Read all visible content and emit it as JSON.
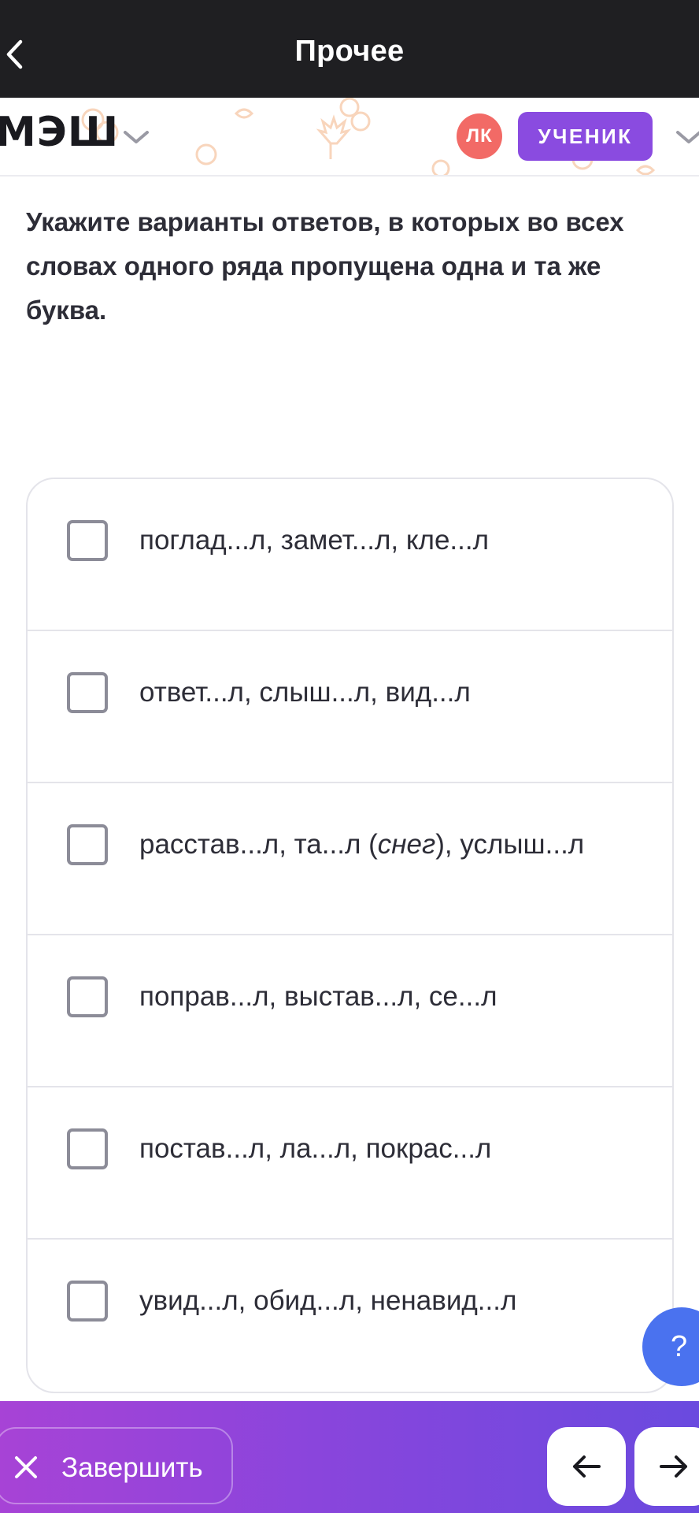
{
  "topbar": {
    "title": "Прочее"
  },
  "header": {
    "logo": "МЭШ",
    "avatar_initials": "ЛК",
    "role": "УЧЕНИК"
  },
  "question": {
    "text": "Укажите варианты ответов, в которых во всех словах одного ряда пропущена одна и та же буква."
  },
  "options": [
    {
      "text": "поглад...л, замет...л, кле...л",
      "checked": false
    },
    {
      "text": "ответ...л, слыш...л, вид...л",
      "checked": false
    },
    {
      "text_before": "расстав...л, та...л (",
      "text_italic": "снег",
      "text_after": "), услыш...л",
      "checked": false
    },
    {
      "text": "поправ...л, выстав...л, се...л",
      "checked": false
    },
    {
      "text": "постав...л, ла...л, покрас...л",
      "checked": false
    },
    {
      "text": "увид...л, обид...л, ненавид...л",
      "checked": false
    }
  ],
  "help": {
    "label": "?"
  },
  "bottombar": {
    "finish_label": "Завершить"
  },
  "colors": {
    "topbar": "#1f1f22",
    "accent_purple": "#8a4be0",
    "avatar": "#f26a66",
    "help": "#4a72ef"
  }
}
